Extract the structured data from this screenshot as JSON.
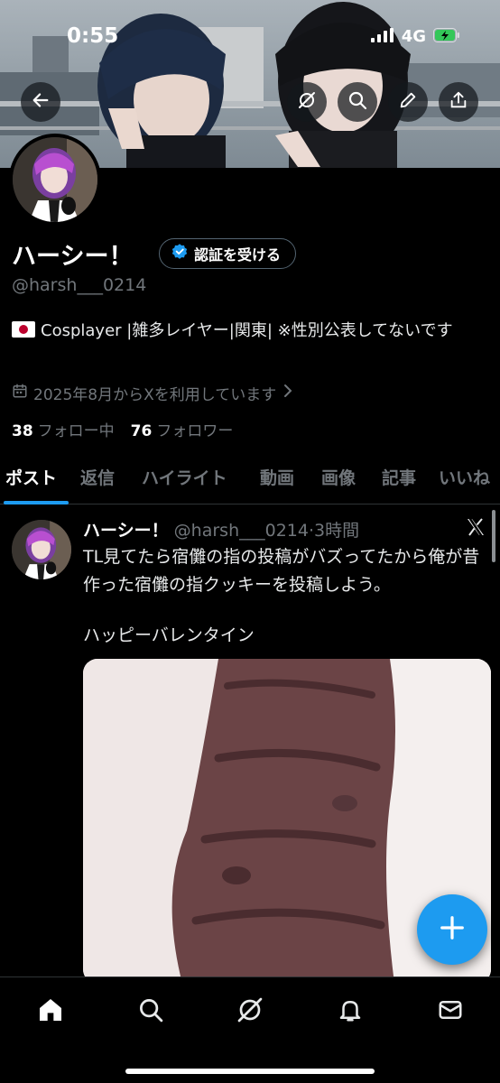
{
  "status": {
    "time": "0:55",
    "network": "4G"
  },
  "profile": {
    "display_name": "ハーシー！",
    "verify_label": "認証を受ける",
    "handle": "@harsh___0214",
    "bio": "Cosplayer |雑多レイヤー|関東| ※性別公表してないです",
    "joined": "2025年8月からXを利用しています",
    "following_count": "38",
    "following_label": "フォロー中",
    "followers_count": "76",
    "followers_label": "フォロワー"
  },
  "tabs": [
    {
      "label": "ポスト",
      "active": true
    },
    {
      "label": "返信"
    },
    {
      "label": "ハイライト"
    },
    {
      "label": "動画"
    },
    {
      "label": "画像"
    },
    {
      "label": "記事"
    },
    {
      "label": "いいね"
    }
  ],
  "post": {
    "author_name": "ハーシー！",
    "author_handle": "@harsh___0214",
    "separator": "·",
    "time": "3時間",
    "text": "TL見てたら宿儺の指の投稿がバズってたから俺が昔作った宿儺の指クッキーを投稿しよう。",
    "text2": "ハッピーバレンタイン"
  },
  "icons": {
    "back": "arrow-left-icon",
    "grok": "grok-icon",
    "search": "search-icon",
    "edit": "pencil-icon",
    "share": "share-icon",
    "calendar": "calendar-icon",
    "verified": "verified-badge-icon",
    "x_logo": "x-logo-icon",
    "compose": "plus-icon",
    "nav": [
      "home-icon",
      "search-icon",
      "grok-icon",
      "bell-icon",
      "mail-icon"
    ]
  },
  "colors": {
    "accent": "#1d9bf0",
    "background": "#000000",
    "muted": "#71767b",
    "text": "#e7e9ea"
  }
}
